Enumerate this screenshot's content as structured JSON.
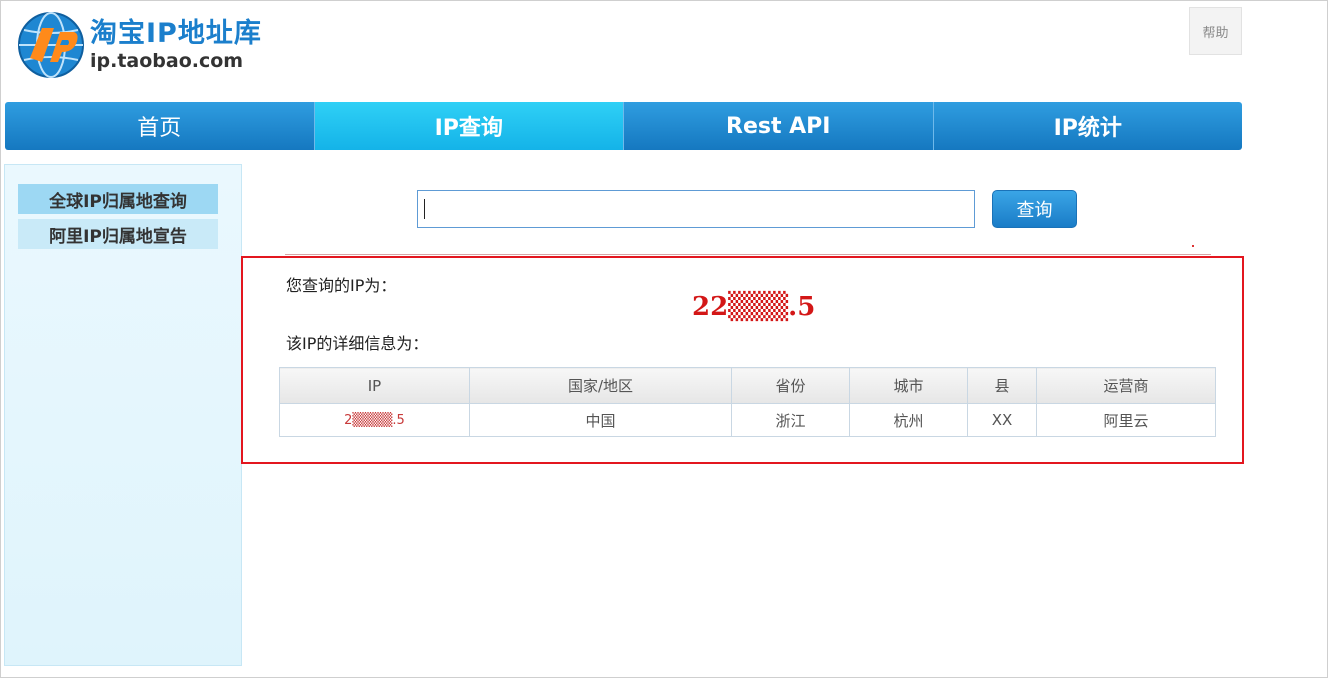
{
  "header": {
    "logo_title": "淘宝IP地址库",
    "logo_url": "ip.taobao.com",
    "help_label": "帮助"
  },
  "nav": {
    "items": [
      {
        "label": "首页"
      },
      {
        "label": "IP查询"
      },
      {
        "label": "Rest API"
      },
      {
        "label": "IP统计"
      }
    ]
  },
  "sidebar": {
    "items": [
      {
        "label": "全球IP归属地查询"
      },
      {
        "label": "阿里IP归属地宣告"
      }
    ]
  },
  "search": {
    "value": "",
    "button_label": "查询"
  },
  "result": {
    "query_label": "您查询的IP为：",
    "ip_display": "22▒▒▒.5",
    "detail_label": "该IP的详细信息为：",
    "columns": [
      "IP",
      "国家/地区",
      "省份",
      "城市",
      "县",
      "运营商"
    ],
    "rows": [
      [
        "2▒▒▒▒.5",
        "中国",
        "浙江",
        "杭州",
        "XX",
        "阿里云"
      ]
    ]
  },
  "colors": {
    "nav_blue": "#1b83c8",
    "nav_active": "#1fc2ef",
    "highlight_red": "#e3161f"
  }
}
